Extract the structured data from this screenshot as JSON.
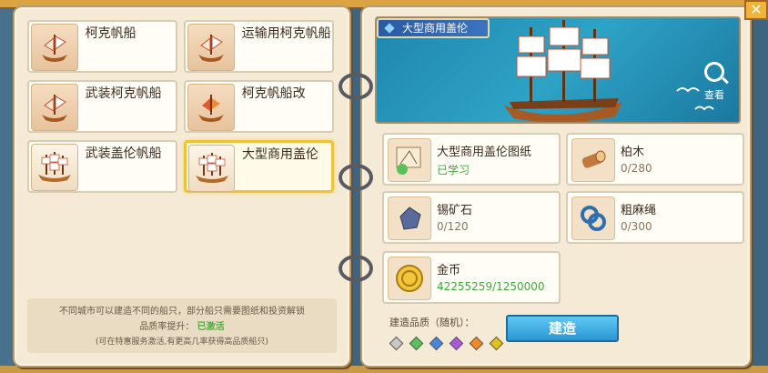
{
  "left_panel": {
    "items": [
      {
        "name": "柯克帆船",
        "thumb": "ship-icon"
      },
      {
        "name": "运输用柯克帆船",
        "thumb": "ship-icon"
      },
      {
        "name": "武装柯克帆船",
        "thumb": "ship-icon"
      },
      {
        "name": "柯克帆船改",
        "thumb": "ship-icon"
      },
      {
        "name": "武装盖伦帆船",
        "thumb": "galleon-icon"
      },
      {
        "name": "大型商用盖伦",
        "thumb": "galleon-icon",
        "selected": true
      }
    ],
    "note_line1": "不同城市可以建造不同的船只，部分船只需要图纸和投资解锁",
    "note_line2_prefix": "品质率提升：",
    "note_line2_status": "已激活",
    "note_line3": "(可在特惠服务激活,有更高几率获得高品质船只)"
  },
  "right_panel": {
    "title": "大型商用盖伦",
    "zoom_label": "查看",
    "materials": [
      {
        "name": "大型商用盖伦图纸",
        "count": "已学习",
        "icon": "blueprint-icon",
        "green": true
      },
      {
        "name": "柏木",
        "count": "0/280",
        "icon": "log-icon"
      },
      {
        "name": "锡矿石",
        "count": "0/120",
        "icon": "ore-icon"
      },
      {
        "name": "粗麻绳",
        "count": "0/300",
        "icon": "rope-icon"
      },
      {
        "name": "金币",
        "count": "42255259/1250000",
        "icon": "coin-icon",
        "green": true
      }
    ],
    "quality_label": "建造品质（随机）：",
    "quality_gem_colors": [
      "#c9c9c9",
      "#5bc05b",
      "#4a86d8",
      "#a95ad8",
      "#f08a2a",
      "#e0c21a"
    ],
    "build_label": "建造"
  },
  "close_label": "✕"
}
